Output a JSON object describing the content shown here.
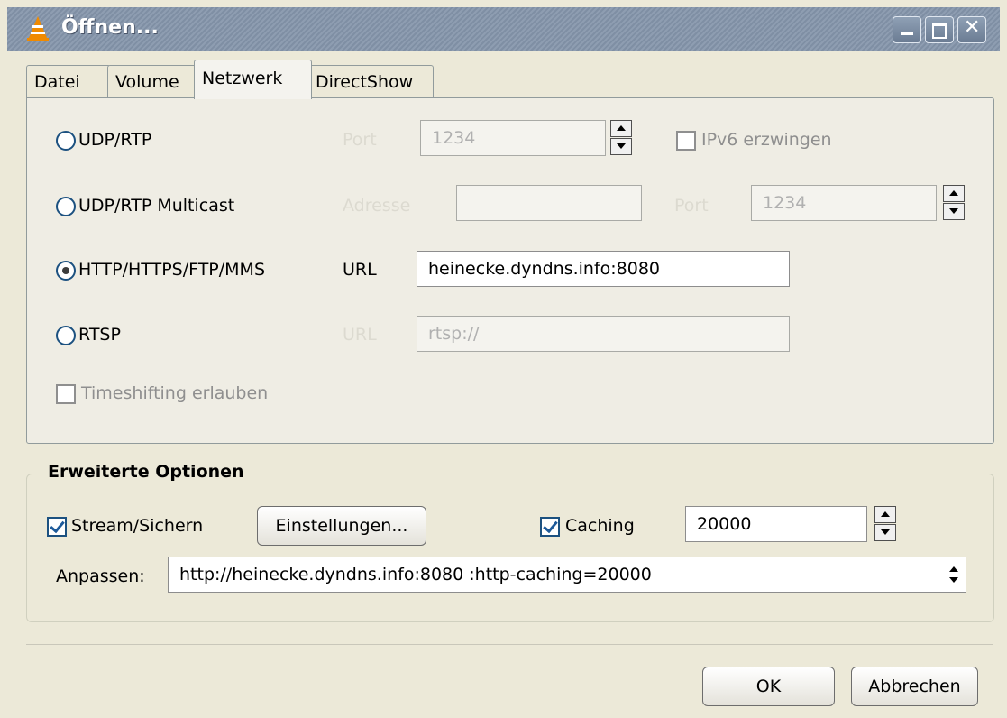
{
  "window": {
    "title": "Öffnen..."
  },
  "tabs": [
    {
      "label": "Datei",
      "active": false
    },
    {
      "label": "Volume",
      "active": false
    },
    {
      "label": "Netzwerk",
      "active": true
    },
    {
      "label": "DirectShow",
      "active": false
    }
  ],
  "protocols": {
    "udp": {
      "label": "UDP/RTP",
      "port_label": "Port",
      "port_value": "1234",
      "ipv6_label": "IPv6 erzwingen",
      "selected": false
    },
    "multicast": {
      "label": "UDP/RTP Multicast",
      "address_label": "Adresse",
      "address_value": "",
      "port_label": "Port",
      "port_value": "1234",
      "selected": false
    },
    "http": {
      "label": "HTTP/HTTPS/FTP/MMS",
      "url_label": "URL",
      "url_value": "heinecke.dyndns.info:8080",
      "selected": true
    },
    "rtsp": {
      "label": "RTSP",
      "url_label": "URL",
      "url_value": "rtsp://",
      "selected": false
    }
  },
  "timeshift": {
    "label": "Timeshifting erlauben",
    "checked": false
  },
  "advanced": {
    "title": "Erweiterte Optionen",
    "stream_label": "Stream/Sichern",
    "stream_checked": true,
    "settings_button": "Einstellungen...",
    "caching_label": "Caching",
    "caching_checked": true,
    "caching_value": "20000",
    "customize_label": "Anpassen:",
    "customize_value": "http://heinecke.dyndns.info:8080  :http-caching=20000"
  },
  "buttons": {
    "ok": "OK",
    "cancel": "Abbrechen"
  },
  "colors": {
    "titlebar": "#8e9db1",
    "background": "#ece9d8",
    "checkmark": "#1d5a9a"
  }
}
